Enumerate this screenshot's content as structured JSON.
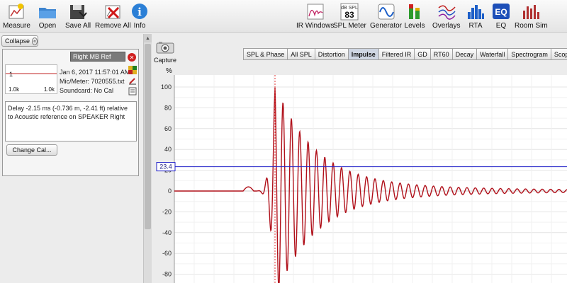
{
  "toolbar": {
    "left": [
      {
        "label": "Measure",
        "icon": "measure-icon"
      },
      {
        "label": "Open",
        "icon": "folder-icon"
      },
      {
        "label": "Save All",
        "icon": "save-icon"
      },
      {
        "label": "Remove All",
        "icon": "remove-icon"
      },
      {
        "label": "Info",
        "icon": "info-icon"
      }
    ],
    "right": [
      {
        "label": "IR Windows",
        "icon": "ir-windows-icon"
      },
      {
        "label": "SPL Meter",
        "icon": "spl-meter-icon",
        "badge_top": "dB SPL",
        "badge_value": "83"
      },
      {
        "label": "Generator",
        "icon": "generator-icon"
      },
      {
        "label": "Levels",
        "icon": "levels-icon"
      },
      {
        "label": "Overlays",
        "icon": "overlays-icon"
      },
      {
        "label": "RTA",
        "icon": "rta-icon"
      },
      {
        "label": "EQ",
        "icon": "eq-icon",
        "badge_value": "EQ"
      },
      {
        "label": "Room Sim",
        "icon": "room-sim-icon"
      }
    ]
  },
  "left_panel": {
    "collapse_label": "Collapse",
    "name_value": "Right MB Ref",
    "thumb_value": "1",
    "thumb_min": "1.0k",
    "thumb_max": "1.0k",
    "date": "Jan 6, 2017 11:57:01 AM",
    "mic_meter": "Mic/Meter: 7020555.txt",
    "soundcard": "Soundcard: No Cal",
    "notes": "Delay -2.15 ms (-0.736 m, -2.41 ft) relative to Acoustic reference on SPEAKER Right",
    "change_cal_label": "Change Cal..."
  },
  "capture_label": "Capture",
  "tabs": [
    {
      "label": "SPL & Phase",
      "active": false
    },
    {
      "label": "All SPL",
      "active": false
    },
    {
      "label": "Distortion",
      "active": false
    },
    {
      "label": "Impulse",
      "active": true
    },
    {
      "label": "Filtered IR",
      "active": false
    },
    {
      "label": "GD",
      "active": false
    },
    {
      "label": "RT60",
      "active": false
    },
    {
      "label": "Decay",
      "active": false
    },
    {
      "label": "Waterfall",
      "active": false
    },
    {
      "label": "Spectrogram",
      "active": false
    },
    {
      "label": "Scope",
      "active": false
    }
  ],
  "graph": {
    "y_unit": "%",
    "y_ticks": [
      100,
      80,
      60,
      40,
      20,
      0,
      -20,
      -40,
      -60,
      -80
    ],
    "cursor_value": "23.4",
    "cursor_y": 23.4,
    "y_max": 100,
    "y_min": -88,
    "trace_color": "#b0101a",
    "cursor_color": "#2020c8",
    "marker_color": "#e03030"
  }
}
